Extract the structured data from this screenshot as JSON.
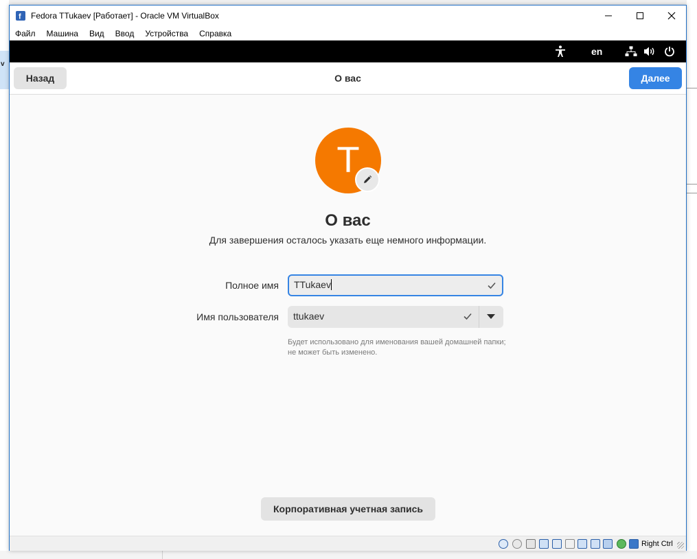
{
  "window": {
    "title": "Fedora TTukaev [Работает] - Oracle VM VirtualBox",
    "controls": [
      "minimize",
      "maximize",
      "close"
    ]
  },
  "menu": [
    "Файл",
    "Машина",
    "Вид",
    "Ввод",
    "Устройства",
    "Справка"
  ],
  "gnome_topbar": {
    "language": "en",
    "icons": [
      "accessibility-icon",
      "network-icon",
      "volume-icon",
      "power-icon"
    ]
  },
  "header": {
    "back_label": "Назад",
    "title": "О вас",
    "next_label": "Далее"
  },
  "avatar": {
    "initial": "T",
    "color": "#f57900"
  },
  "page": {
    "heading": "О вас",
    "subtitle": "Для завершения осталось указать еще немного информации."
  },
  "form": {
    "full_name_label": "Полное имя",
    "full_name_value": "TTukaev",
    "username_label": "Имя пользователя",
    "username_value": "ttukaev",
    "hint": "Будет использовано для именования вашей домашней папки; не может быть изменено."
  },
  "enterprise_button": "Корпоративная учетная запись",
  "statusbar": {
    "host_key": "Right Ctrl"
  },
  "background": {
    "left_fragment": "v"
  },
  "colors": {
    "accent": "#3584e4",
    "avatar": "#f57900",
    "topbar": "#000000"
  }
}
